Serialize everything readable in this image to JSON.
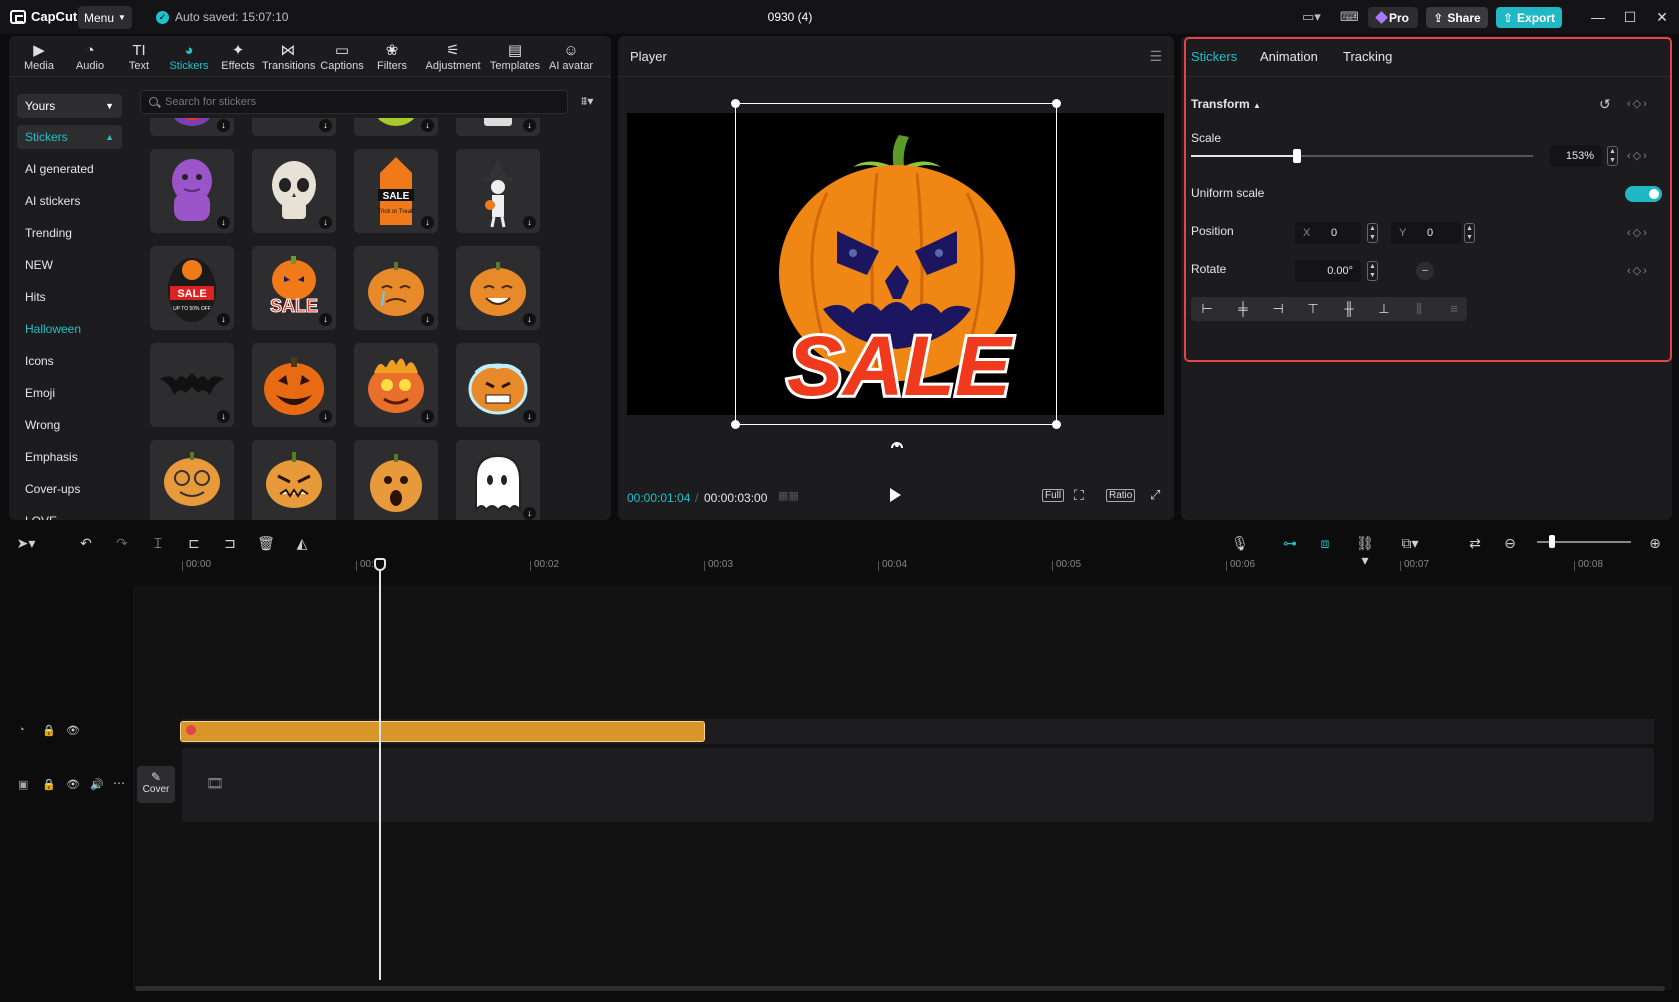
{
  "app": {
    "logo": "CapCut",
    "menu_label": "Menu",
    "autosave": "Auto saved: 15:07:10",
    "project_title": "0930 (4)"
  },
  "titlebar": {
    "pro_label": "Pro",
    "share_label": "Share",
    "export_label": "Export"
  },
  "toolbar": {
    "tabs": [
      {
        "label": "Media",
        "icon": "media-icon"
      },
      {
        "label": "Audio",
        "icon": "audio-icon"
      },
      {
        "label": "Text",
        "icon": "text-icon"
      },
      {
        "label": "Stickers",
        "icon": "stickers-icon"
      },
      {
        "label": "Effects",
        "icon": "effects-icon"
      },
      {
        "label": "Transitions",
        "icon": "transitions-icon"
      },
      {
        "label": "Captions",
        "icon": "captions-icon"
      },
      {
        "label": "Filters",
        "icon": "filters-icon"
      },
      {
        "label": "Adjustment",
        "icon": "adjustment-icon"
      },
      {
        "label": "Templates",
        "icon": "templates-icon"
      },
      {
        "label": "AI avatar",
        "icon": "ai-avatar-icon"
      }
    ],
    "active": "Stickers"
  },
  "stickers": {
    "dropdown": "Yours",
    "search_placeholder": "Search for stickers",
    "categories": [
      "Stickers",
      "AI generated",
      "AI stickers",
      "Trending",
      "NEW",
      "Hits",
      "Halloween",
      "Icons",
      "Emoji",
      "Wrong",
      "Emphasis",
      "Cover-ups",
      "LOVE"
    ],
    "selected_category": "Stickers",
    "highlighted_category": "Halloween",
    "tile_texts": {
      "sale": "SALE",
      "trick": "Trick or Treat!",
      "up_to": "UP TO 50% OFF"
    }
  },
  "player": {
    "title": "Player",
    "current_time": "00:00:01:04",
    "duration": "00:00:03:00",
    "sticker_text": "SALE",
    "buttons": {
      "full": "Full",
      "ratio": "Ratio"
    }
  },
  "inspector": {
    "tabs": [
      "Stickers",
      "Animation",
      "Tracking"
    ],
    "active_tab": "Stickers",
    "section": "Transform",
    "scale_label": "Scale",
    "scale_value": "153%",
    "scale_fraction": 0.31,
    "uniform_label": "Uniform scale",
    "uniform_on": true,
    "position_label": "Position",
    "x_label": "X",
    "x_value": "0",
    "y_label": "Y",
    "y_value": "0",
    "rotate_label": "Rotate",
    "rotate_value": "0.00°"
  },
  "timeline": {
    "ruler": [
      "00:00",
      "00:01",
      "00:02",
      "00:03",
      "00:04",
      "00:05",
      "00:06",
      "00:07",
      "00:08"
    ],
    "cover_label": "Cover"
  },
  "colors": {
    "accent": "#1fc0c8",
    "clip": "#d8962a",
    "highlight": "#e4434b"
  }
}
